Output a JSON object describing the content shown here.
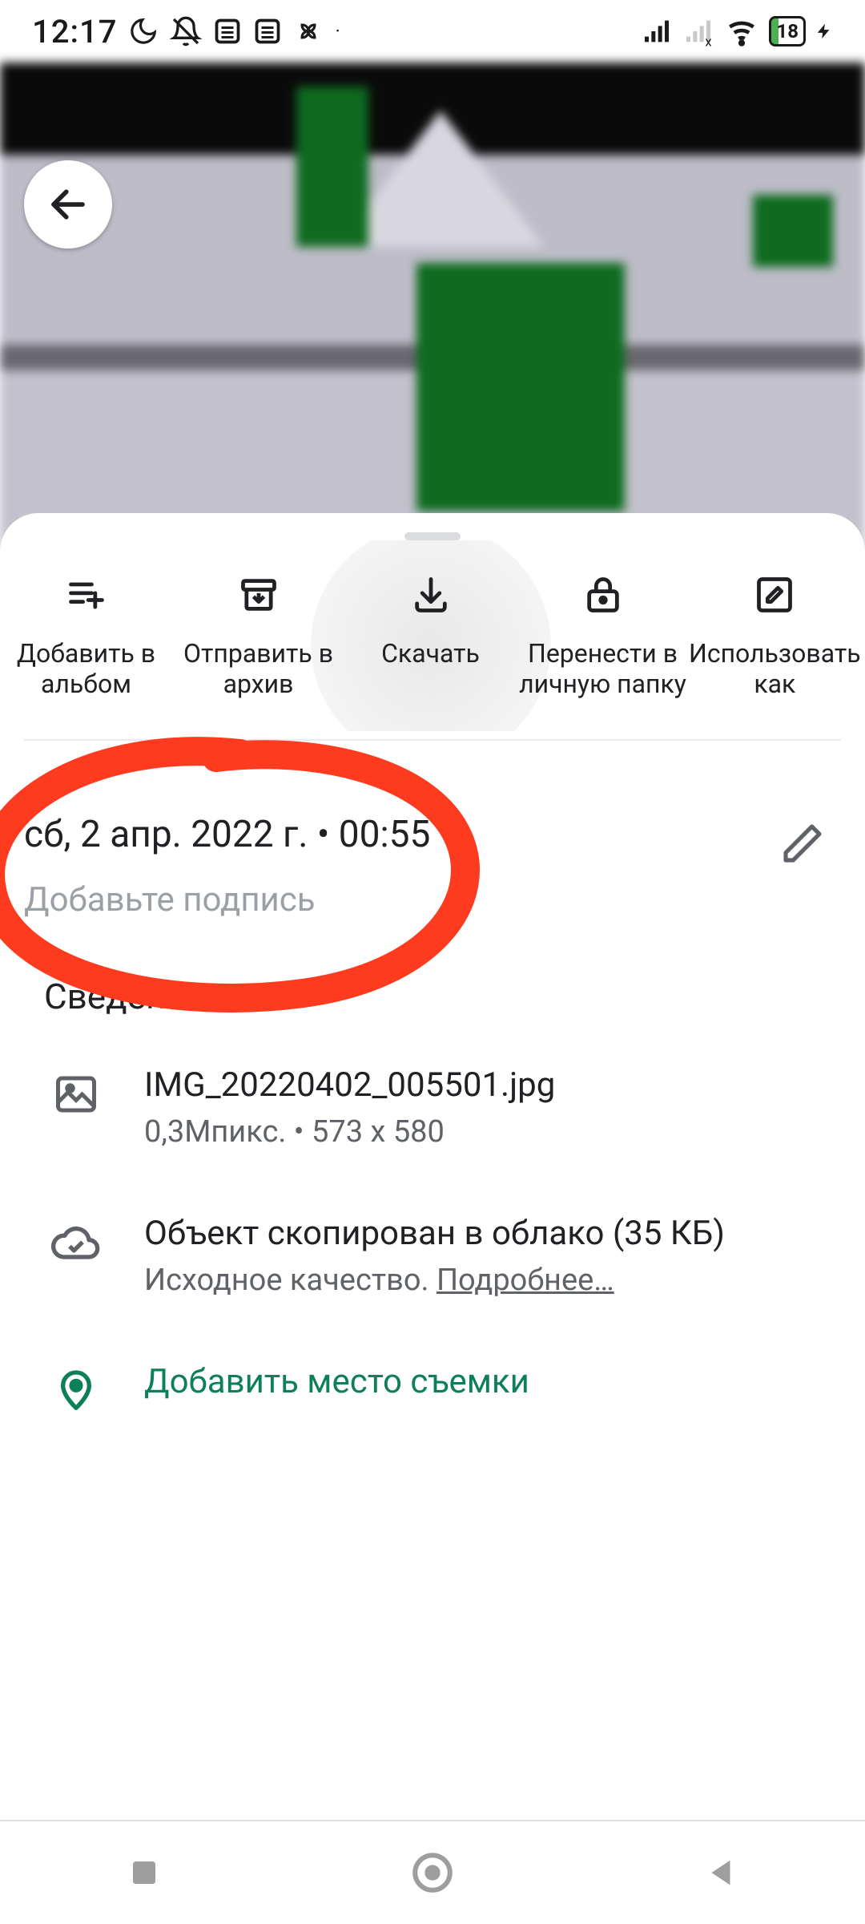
{
  "status": {
    "time": "12:17",
    "battery_pct": "18"
  },
  "actions": {
    "add_album": "Добавить в альбом",
    "archive": "Отправить в архив",
    "download": "Скачать",
    "move_private": "Перенести в личную папку",
    "use_as_partial": "Использовать как"
  },
  "date": {
    "line": "сб, 2 апр. 2022 г.  •  00:55",
    "caption_placeholder": "Добавьте подпись"
  },
  "details": {
    "heading": "Сведения",
    "filename": "IMG_20220402_005501.jpg",
    "filesub": "0,3Мпикс.  •  573 x 580",
    "cloud_primary": "Объект скопирован в облако (35 КБ)",
    "cloud_secondary_prefix": "Исходное качество. ",
    "cloud_link": "Подробнее…",
    "add_location": "Добавить место съемки"
  }
}
